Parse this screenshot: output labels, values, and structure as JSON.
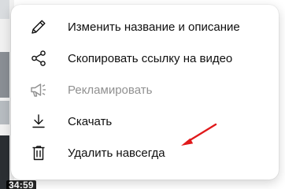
{
  "thumbnail": {
    "duration": "34:59"
  },
  "menu": {
    "items": [
      {
        "label": "Изменить название и описание",
        "icon": "pencil-icon",
        "enabled": true
      },
      {
        "label": "Скопировать ссылку на видео",
        "icon": "share-icon",
        "enabled": true
      },
      {
        "label": "Рекламировать",
        "icon": "megaphone-icon",
        "enabled": false
      },
      {
        "label": "Скачать",
        "icon": "download-icon",
        "enabled": true
      },
      {
        "label": "Удалить навсегда",
        "icon": "trash-icon",
        "enabled": true
      }
    ]
  },
  "colors": {
    "text": "#0f0f0f",
    "disabled_text": "#909090",
    "annotation_arrow": "#e0191b"
  }
}
